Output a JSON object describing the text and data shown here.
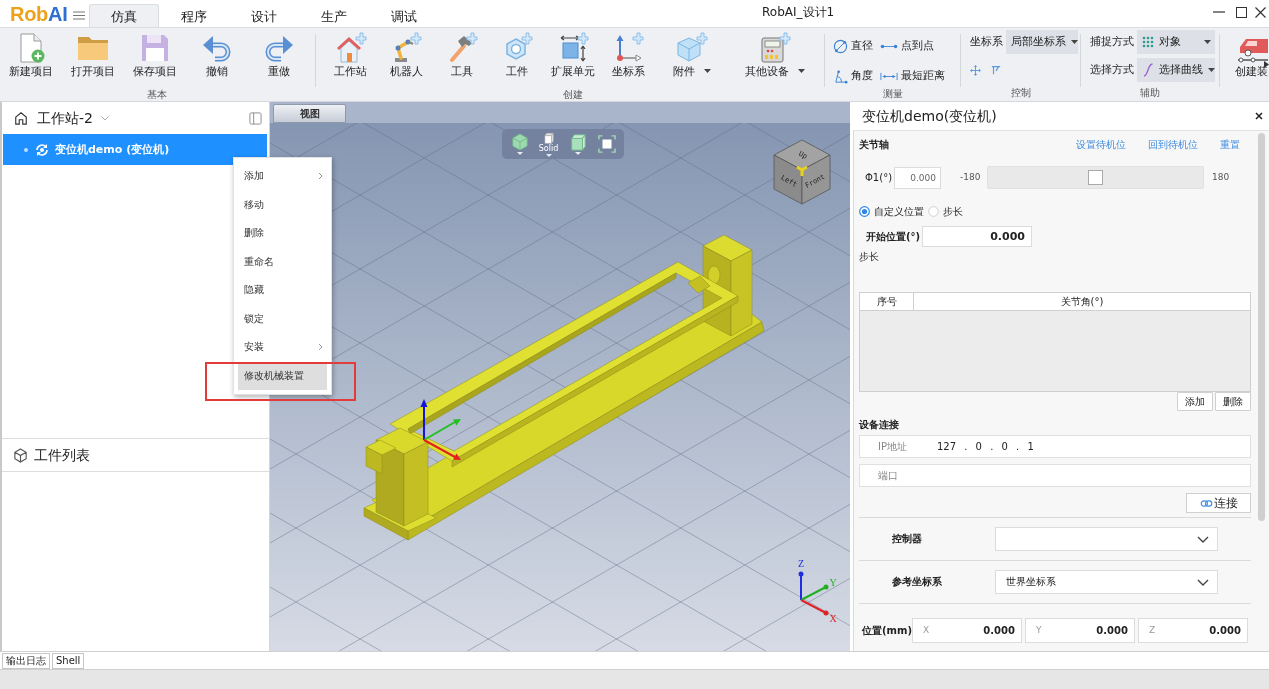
{
  "logo": [
    {
      "text": "Rob"
    },
    {
      "text": "AI"
    }
  ],
  "tabs": [
    {
      "label": "仿真",
      "selected": true
    },
    {
      "label": "程序",
      "selected": false
    },
    {
      "label": "设计",
      "selected": false
    },
    {
      "label": "生产",
      "selected": false
    },
    {
      "label": "调试",
      "selected": false
    }
  ],
  "window": {
    "title": "RobAI_设计1"
  },
  "ribbon": {
    "groups": [
      {
        "kind": "large",
        "label": "基本",
        "items": [
          {
            "label": "新建项目",
            "dropdown": false
          },
          {
            "label": "打开项目",
            "dropdown": false
          },
          {
            "label": "保存项目",
            "dropdown": false
          },
          {
            "label": "撤销",
            "dropdown": false
          },
          {
            "label": "重做",
            "dropdown": false
          }
        ]
      },
      {
        "kind": "large",
        "label": "创建",
        "items": [
          {
            "label": "工作站",
            "dropdown": false
          },
          {
            "label": "机器人",
            "dropdown": false
          },
          {
            "label": "工具",
            "dropdown": false
          },
          {
            "label": "工件",
            "dropdown": false
          },
          {
            "label": "扩展单元",
            "dropdown": false
          },
          {
            "label": "坐标系",
            "dropdown": false
          },
          {
            "label": "附件",
            "dropdown": true
          },
          {
            "label": "其他设备",
            "dropdown": true
          }
        ]
      },
      {
        "kind": "small",
        "label": "测量",
        "items": [
          {
            "label": "直径"
          },
          {
            "label": "点到点"
          },
          {
            "label": "角度"
          },
          {
            "label": "最短距离"
          }
        ]
      },
      {
        "kind": "form",
        "label": "控制",
        "rows": [
          {
            "kind": "select",
            "label": "坐标系",
            "value": "局部坐标系"
          },
          {
            "kind": "tools"
          }
        ]
      },
      {
        "kind": "form",
        "label": "辅助",
        "rows": [
          {
            "kind": "select",
            "label": "捕捉方式",
            "value": "对象"
          },
          {
            "kind": "select",
            "label": "选择方式",
            "value": "选择曲线"
          }
        ]
      },
      {
        "kind": "large",
        "items": [
          {
            "label": "创建装",
            "dropdown": false
          }
        ]
      }
    ]
  },
  "station": {
    "title": "工作站-2",
    "items": [
      {
        "label": "变位机demo (变位机)",
        "selected": true
      }
    ]
  },
  "context_menu": {
    "items": [
      {
        "label": "添加",
        "submenu": true,
        "selected": false,
        "annotated": false
      },
      {
        "label": "移动",
        "submenu": false,
        "selected": false,
        "annotated": false
      },
      {
        "label": "删除",
        "submenu": false,
        "selected": false,
        "annotated": false
      },
      {
        "label": "重命名",
        "submenu": false,
        "selected": false,
        "annotated": false
      },
      {
        "label": "隐藏",
        "submenu": false,
        "selected": false,
        "annotated": false
      },
      {
        "label": "锁定",
        "submenu": false,
        "selected": false,
        "annotated": false
      },
      {
        "label": "安装",
        "submenu": true,
        "selected": false,
        "annotated": false
      },
      {
        "label": "修改机械装置",
        "submenu": false,
        "selected": true,
        "annotated": true
      }
    ]
  },
  "parts_list": {
    "title": "工件列表"
  },
  "viewport": {
    "tab": "视图",
    "tools": [
      {
        "dropdown": true
      },
      {
        "dropdown": true,
        "caption": "Solid"
      },
      {
        "dropdown": true
      },
      {
        "dropdown": false
      }
    ],
    "view_cube": [
      "Up",
      "Left",
      "Front"
    ],
    "triad": [
      {
        "label": "Z",
        "color": "#1f2fe0"
      },
      {
        "label": "Y",
        "color": "#22b022"
      },
      {
        "label": "X",
        "color": "#e02424"
      }
    ]
  },
  "properties": {
    "title": "变位机demo(变位机)",
    "joint": {
      "heading": "关节轴",
      "links": [
        "设置待机位",
        "回到待机位",
        "重置"
      ],
      "axes": [
        {
          "label": "Φ1(°)",
          "value": "0.000",
          "min": "-180",
          "max": "180",
          "level": 0.5
        }
      ]
    },
    "modes": [
      {
        "label": "自定义位置",
        "selected": true
      },
      {
        "label": "步长",
        "selected": false
      }
    ],
    "start": {
      "label": "开始位置(°)",
      "value": "0.000"
    },
    "step": {
      "label": "步长"
    },
    "table": {
      "columns": [
        "序号",
        "关节角(°)"
      ],
      "buttons": [
        "添加",
        "删除"
      ]
    },
    "connection": {
      "heading": "设备连接",
      "fields": [
        {
          "label": "IP地址",
          "value": "127 . 0 . 0 . 1"
        },
        {
          "label": "端口"
        }
      ],
      "button": "连接"
    },
    "selects": [
      {
        "label": "控制器"
      },
      {
        "label": "参考坐标系",
        "value": "世界坐标系"
      }
    ],
    "position": {
      "label": "位置(mm)",
      "fields": [
        {
          "axis": "X",
          "value": "0.000"
        },
        {
          "axis": "Y",
          "value": "0.000"
        },
        {
          "axis": "Z",
          "value": "0.000"
        }
      ]
    }
  },
  "bottom_tabs": [
    {
      "label": "输出日志"
    },
    {
      "label": "Shell"
    }
  ]
}
